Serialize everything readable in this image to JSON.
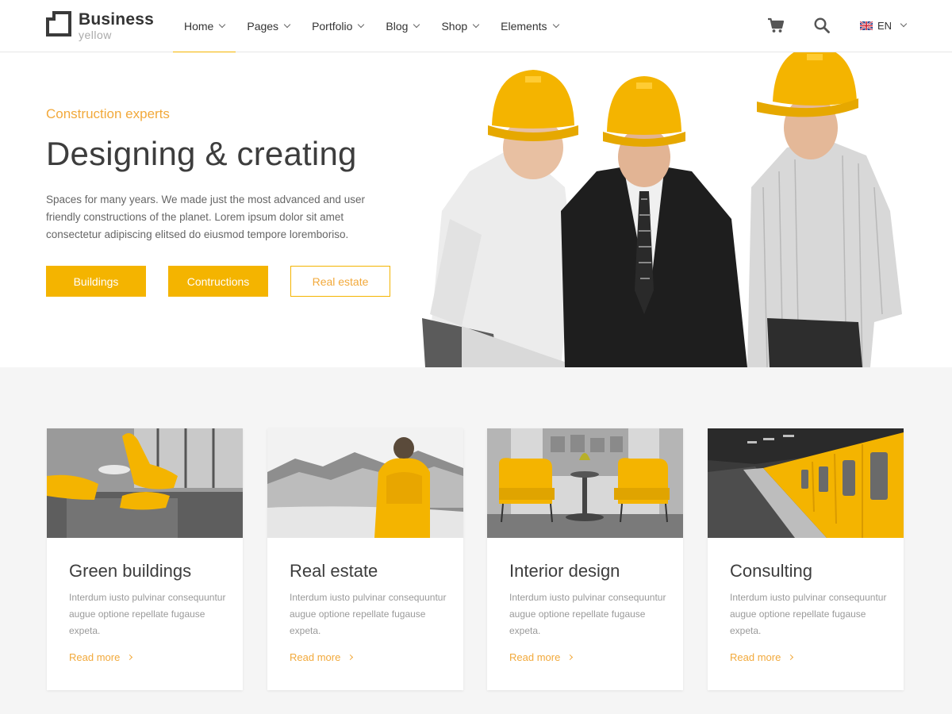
{
  "brand": {
    "title": "Business",
    "subtitle": "yellow",
    "accent": "#f4b400"
  },
  "nav": {
    "items": [
      {
        "label": "Home",
        "active": true
      },
      {
        "label": "Pages"
      },
      {
        "label": "Portfolio"
      },
      {
        "label": "Blog"
      },
      {
        "label": "Shop"
      },
      {
        "label": "Elements"
      }
    ],
    "icons": [
      "cart-icon",
      "search-icon"
    ],
    "language": "EN"
  },
  "hero": {
    "kicker": "Construction experts",
    "title": "Designing & creating",
    "text": "Spaces for many years. We made just the most advanced and user friendly constructions of the planet. Lorem ipsum dolor sit amet consectetur adipiscing elitsed do eiusmod tempore loremboriso.",
    "buttons": [
      "Buildings",
      "Contructions",
      "Real estate"
    ]
  },
  "services": [
    {
      "title": "Green buildings",
      "text": "Interdum iusto pulvinar consequuntur augue optione repellate fugause expeta.",
      "link": "Read more"
    },
    {
      "title": "Real estate",
      "text": "Interdum iusto pulvinar consequuntur augue optione repellate fugause expeta.",
      "link": "Read more"
    },
    {
      "title": "Interior design",
      "text": "Interdum iusto pulvinar consequuntur augue optione repellate fugause expeta.",
      "link": "Read more"
    },
    {
      "title": "Consulting",
      "text": "Interdum iusto pulvinar consequuntur augue optione repellate fugause expeta.",
      "link": "Read more"
    }
  ]
}
